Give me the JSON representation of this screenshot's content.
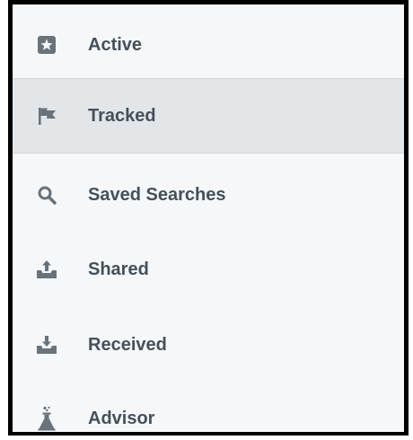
{
  "colors": {
    "background": "#f5f7f9",
    "selected_background": "#e3e6e9",
    "text": "#45505a",
    "icon": "#68737c",
    "frame_border": "#000000"
  },
  "nav": {
    "items": [
      {
        "label": "Active",
        "icon": "star-box-icon",
        "selected": false
      },
      {
        "label": "Tracked",
        "icon": "flag-icon",
        "selected": true
      },
      {
        "label": "Saved Searches",
        "icon": "search-icon",
        "selected": false
      },
      {
        "label": "Shared",
        "icon": "upload-tray-icon",
        "selected": false
      },
      {
        "label": "Received",
        "icon": "download-tray-icon",
        "selected": false
      },
      {
        "label": "Advisor",
        "icon": "flask-icon",
        "selected": false
      }
    ]
  }
}
